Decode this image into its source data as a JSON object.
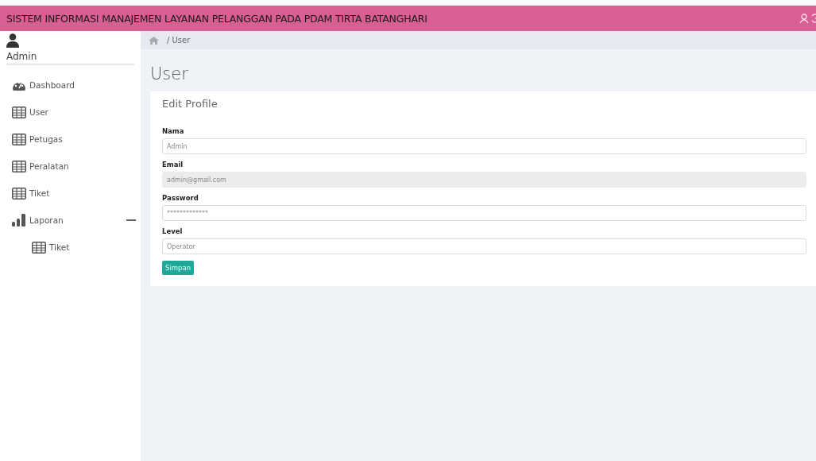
{
  "header": {
    "title": "SISTEM INFORMASI MANAJEMEN LAYANAN PELANGGAN PADA PDAM TIRTA BATANGHARI"
  },
  "sidebar": {
    "user": "Admin",
    "items": [
      {
        "label": "Dashboard",
        "kind": "dashboard"
      },
      {
        "label": "User",
        "kind": "table"
      },
      {
        "label": "Petugas",
        "kind": "table"
      },
      {
        "label": "Peralatan",
        "kind": "table"
      },
      {
        "label": "Tiket",
        "kind": "table"
      },
      {
        "label": "Laporan",
        "kind": "chart",
        "expanded": true,
        "children": [
          {
            "label": "Tiket",
            "kind": "table"
          }
        ]
      }
    ]
  },
  "breadcrumb": "/ User",
  "page_title": "User",
  "card": {
    "title": "Edit Profile",
    "fields": [
      {
        "label": "Nama",
        "value": "Admin",
        "disabled": false
      },
      {
        "label": "Email",
        "value": "admin@gmail.com",
        "disabled": true
      },
      {
        "label": "Password",
        "value": "*************",
        "disabled": false
      },
      {
        "label": "Level",
        "value": "Operator",
        "disabled": false
      }
    ],
    "button": "Simpan"
  }
}
